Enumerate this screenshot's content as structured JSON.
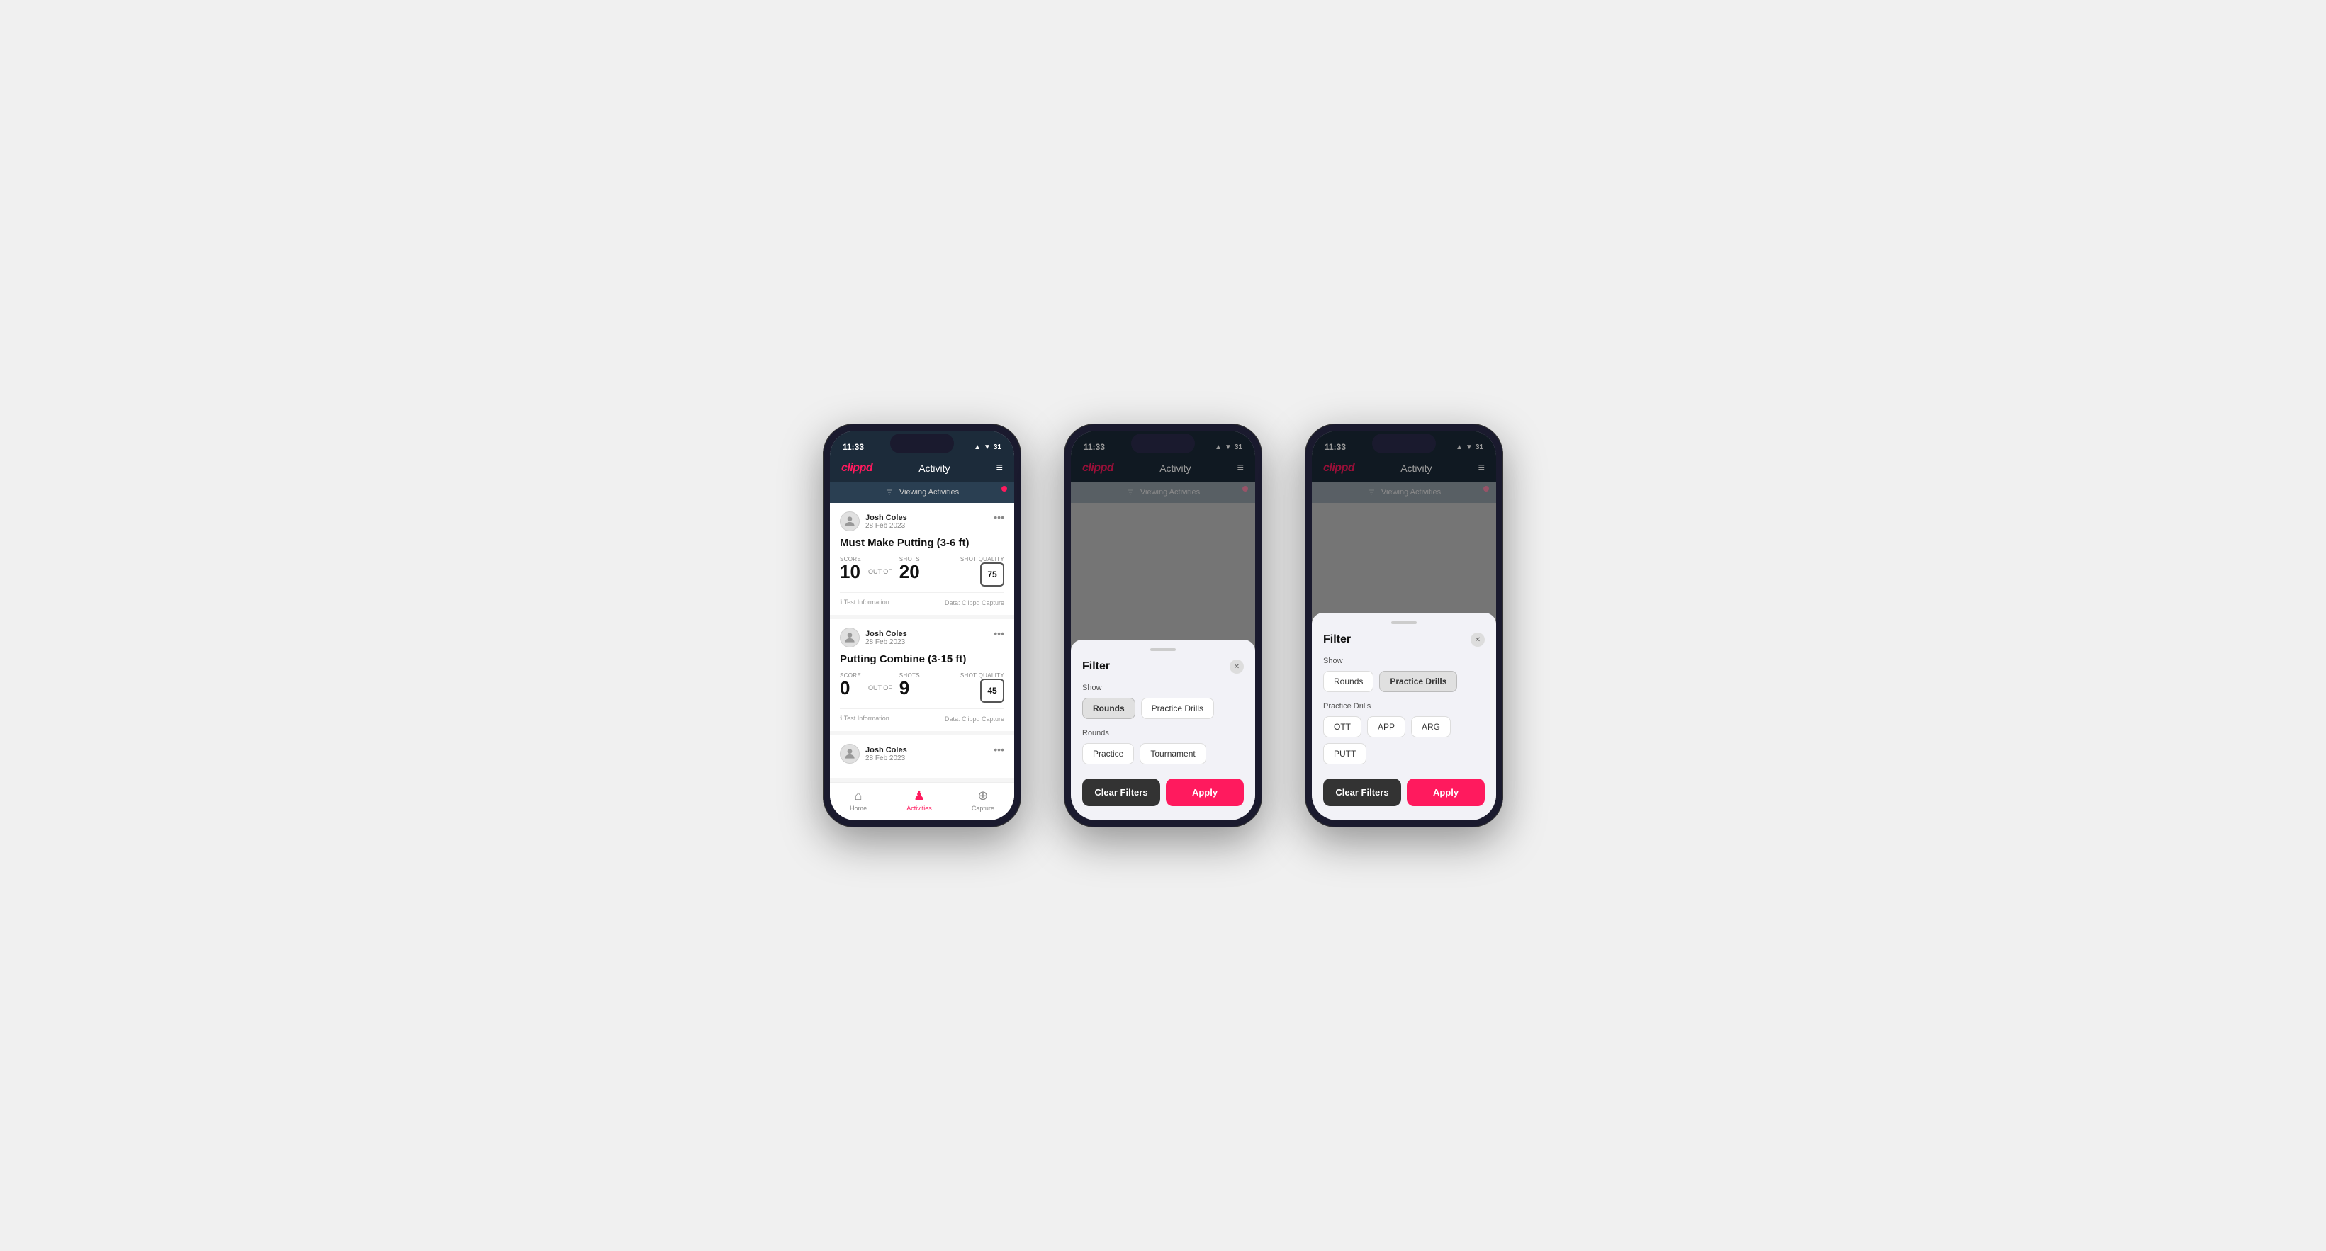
{
  "app": {
    "logo": "clippd",
    "header_title": "Activity",
    "status_time": "11:33",
    "status_icons": "▲ ▼ WiFi 31"
  },
  "phone1": {
    "viewing_banner": "Viewing Activities",
    "activities": [
      {
        "user_name": "Josh Coles",
        "user_date": "28 Feb 2023",
        "title": "Must Make Putting (3-6 ft)",
        "score_label": "Score",
        "score_value": "10",
        "out_of_text": "OUT OF",
        "shots_label": "Shots",
        "shots_value": "20",
        "shot_quality_label": "Shot Quality",
        "shot_quality_value": "75",
        "footer_info": "Test Information",
        "footer_data": "Data: Clippd Capture"
      },
      {
        "user_name": "Josh Coles",
        "user_date": "28 Feb 2023",
        "title": "Putting Combine (3-15 ft)",
        "score_label": "Score",
        "score_value": "0",
        "out_of_text": "OUT OF",
        "shots_label": "Shots",
        "shots_value": "9",
        "shot_quality_label": "Shot Quality",
        "shot_quality_value": "45",
        "footer_info": "Test Information",
        "footer_data": "Data: Clippd Capture"
      },
      {
        "user_name": "Josh Coles",
        "user_date": "28 Feb 2023",
        "title": "",
        "score_label": "",
        "score_value": "",
        "out_of_text": "",
        "shots_label": "",
        "shots_value": "",
        "shot_quality_label": "",
        "shot_quality_value": "",
        "footer_info": "",
        "footer_data": ""
      }
    ],
    "nav": {
      "home_label": "Home",
      "activities_label": "Activities",
      "capture_label": "Capture"
    }
  },
  "phone2": {
    "viewing_banner": "Viewing Activities",
    "filter": {
      "title": "Filter",
      "show_label": "Show",
      "rounds_btn": "Rounds",
      "practice_drills_btn": "Practice Drills",
      "rounds_section_label": "Rounds",
      "practice_btn": "Practice",
      "tournament_btn": "Tournament",
      "clear_label": "Clear Filters",
      "apply_label": "Apply",
      "active_tab": "rounds"
    }
  },
  "phone3": {
    "viewing_banner": "Viewing Activities",
    "filter": {
      "title": "Filter",
      "show_label": "Show",
      "rounds_btn": "Rounds",
      "practice_drills_btn": "Practice Drills",
      "practice_drills_section_label": "Practice Drills",
      "ott_btn": "OTT",
      "app_btn": "APP",
      "arg_btn": "ARG",
      "putt_btn": "PUTT",
      "clear_label": "Clear Filters",
      "apply_label": "Apply",
      "active_tab": "practice_drills"
    }
  }
}
